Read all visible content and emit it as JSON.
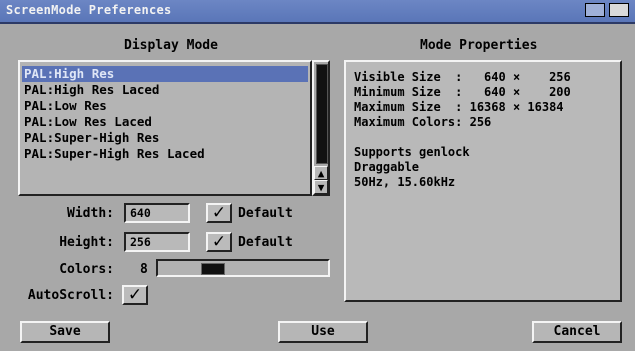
{
  "window": {
    "title": "ScreenMode Preferences"
  },
  "display_mode": {
    "heading": "Display Mode",
    "items": [
      {
        "label": "PAL:High Res",
        "selected": true
      },
      {
        "label": "PAL:High Res Laced",
        "selected": false
      },
      {
        "label": "PAL:Low Res",
        "selected": false
      },
      {
        "label": "PAL:Low Res Laced",
        "selected": false
      },
      {
        "label": "PAL:Super-High Res",
        "selected": false
      },
      {
        "label": "PAL:Super-High Res Laced",
        "selected": false
      }
    ]
  },
  "width": {
    "label": "Width:",
    "value": "640",
    "default_label": "Default",
    "default_checked": true
  },
  "height": {
    "label": "Height:",
    "value": "256",
    "default_label": "Default",
    "default_checked": true
  },
  "colors": {
    "label": "Colors:",
    "value": "8",
    "slider_fraction": 0.3
  },
  "autoscroll": {
    "label": "AutoScroll:",
    "checked": true
  },
  "properties": {
    "heading": "Mode Properties",
    "rows": [
      "Visible Size  :   640 ×    256",
      "Minimum Size  :   640 ×    200",
      "Maximum Size  : 16368 × 16384",
      "Maximum Colors: 256",
      "",
      "Supports genlock",
      "Draggable",
      "50Hz, 15.60kHz"
    ]
  },
  "buttons": {
    "save": "Save",
    "use": "Use",
    "cancel": "Cancel"
  },
  "colors_theme": {
    "window": "#a8a8a8",
    "title_bar": "#5a76b8",
    "selection": "#5a72b6"
  },
  "icons": {
    "check": "✓",
    "up": "▲",
    "down": "▼"
  }
}
